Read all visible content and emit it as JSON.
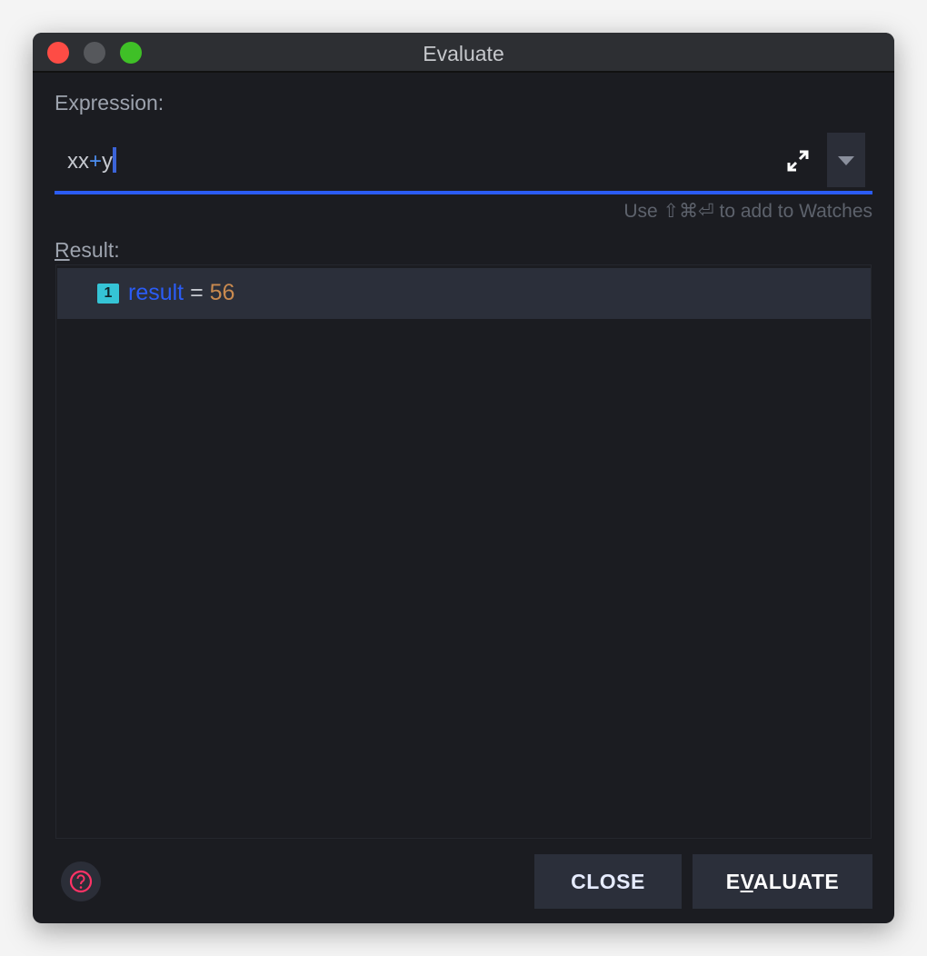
{
  "window": {
    "title": "Evaluate"
  },
  "expression": {
    "label": "Expression:",
    "value_parts": [
      "xx",
      "+",
      "y"
    ],
    "hint": "Use ⇧⌘⏎ to add to Watches"
  },
  "result": {
    "label_underlined": "R",
    "label_rest": "esult:",
    "rows": [
      {
        "badge": "1",
        "name": "result",
        "eq": "=",
        "value": "56"
      }
    ]
  },
  "buttons": {
    "close": "CLOSE",
    "evaluate_pre": "E",
    "evaluate_mnemonic": "V",
    "evaluate_post": "ALUATE"
  },
  "colors": {
    "accent": "#2b5cf5",
    "name": "#2b5cf5",
    "value": "#c98a4f",
    "help": "#ff3366"
  }
}
